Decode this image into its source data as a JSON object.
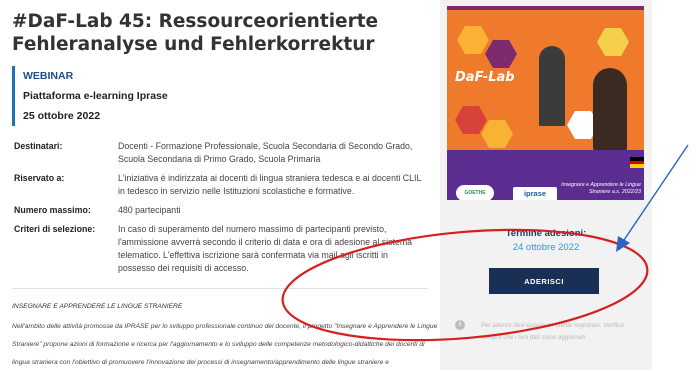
{
  "page": {
    "title": "#DaF-Lab 45: Ressourceorientierte Fehleranalyse und Fehlerkorrektur",
    "info": {
      "type": "WEBINAR",
      "platform": "Piattaforma e-learning Iprase",
      "date": "25 ottobre 2022"
    },
    "details": [
      {
        "label": "Destinatari:",
        "value": "Docenti - Formazione Professionale, Scuola Secondaria di Secondo Grado, Scuola Secondaria di Primo Grado, Scuola Primaria"
      },
      {
        "label": "Riservato a:",
        "value": "L'iniziativa è indirizzata ai docenti di lingua straniera tedesca e ai docenti CLIL in tedesco in servizio nelle Istituzioni scolastiche e formative."
      },
      {
        "label": "Numero massimo:",
        "value": "480 partecipanti"
      },
      {
        "label": "Criteri di selezione:",
        "value": "In caso di superamento del numero massimo di partecipanti previsto, l'ammissione avverrà secondo il criterio di data e ora di adesione al sistema telematico. L'effettiva iscrizione sarà confermata via mail agli iscritti in possesso dei requisiti di accesso."
      }
    ],
    "section_heading": "INSEGNARE E APPRENDERE LE LINGUE STRANIERE",
    "section_body": "Nell'ambito delle attività promosse da IPRASE per lo sviluppo professionale continuo del docente, il progetto \"Insegnare e Apprendere le Lingue Straniere\" propone azioni di formazione e ricerca per l'aggiornamento e lo sviluppo delle competenze metodologico-didattiche dei docenti di lingua straniera con l'obiettivo di promuovere l'innovazione dei processi di insegnamento/apprendimento delle lingue straniere e"
  },
  "sidebar": {
    "banner": {
      "brand": "DaF-Lab",
      "goethe": "GOETHE INSTITUT",
      "iprase": "iprase",
      "caption": "Insegnare e Apprendere le Lingue Straniere a.s. 2022/23"
    },
    "deadline_label": "Termine adesioni:",
    "deadline_date": "24 ottobre 2022",
    "button": "ADERISCI",
    "note": "Per aderire devi essere un utente registrato. Verifica sempre che i tuoi dati siano aggiornati"
  },
  "colors": {
    "accent": "#1e72b6",
    "button": "#1a2f55",
    "link": "#2a9ae0",
    "annotation": "#d62020"
  }
}
